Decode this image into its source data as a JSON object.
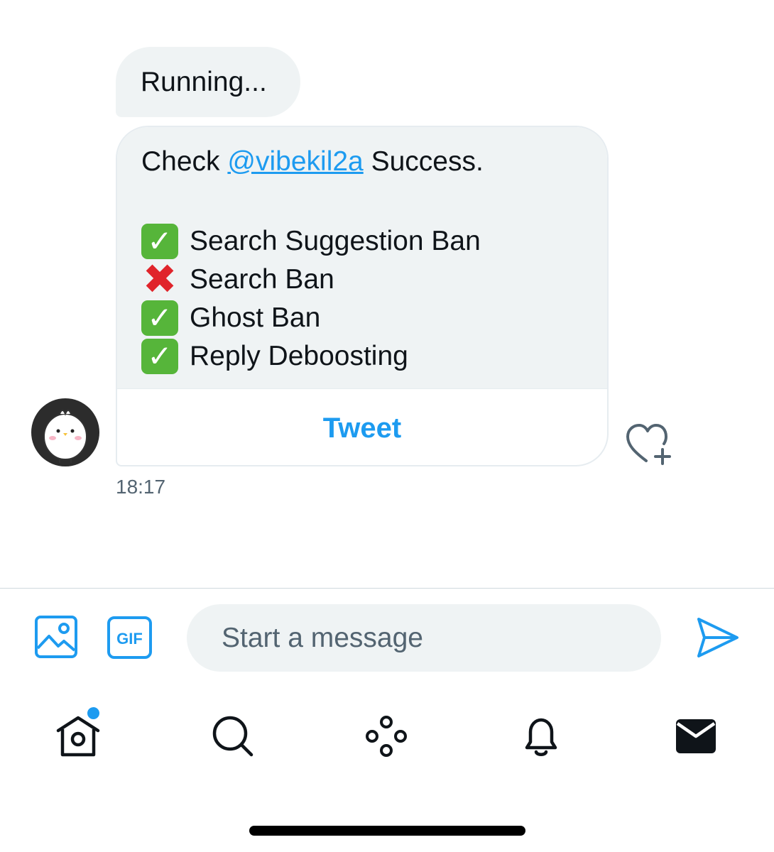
{
  "messages": {
    "running_text": "Running...",
    "card": {
      "prefix": "Check ",
      "mention": "@vibekil2a",
      "suffix": " Success.",
      "results": [
        {
          "label": "Search Suggestion Ban",
          "status": "pass",
          "icon": "check-mark-icon"
        },
        {
          "label": "Search Ban",
          "status": "fail",
          "icon": "cross-mark-icon"
        },
        {
          "label": "Ghost Ban",
          "status": "pass",
          "icon": "check-mark-icon"
        },
        {
          "label": "Reply Deboosting",
          "status": "pass",
          "icon": "check-mark-icon"
        }
      ],
      "action_label": "Tweet"
    },
    "timestamp": "18:17"
  },
  "composer": {
    "placeholder": "Start a message",
    "gif_label": "GIF"
  },
  "nav": {
    "items": [
      "home",
      "search",
      "spaces",
      "notifications",
      "messages"
    ],
    "active": "messages",
    "home_has_notification": true
  },
  "colors": {
    "accent": "#1d9bf0",
    "bubble": "#eff3f4",
    "pass": "#56b53a",
    "fail": "#e0242b"
  }
}
